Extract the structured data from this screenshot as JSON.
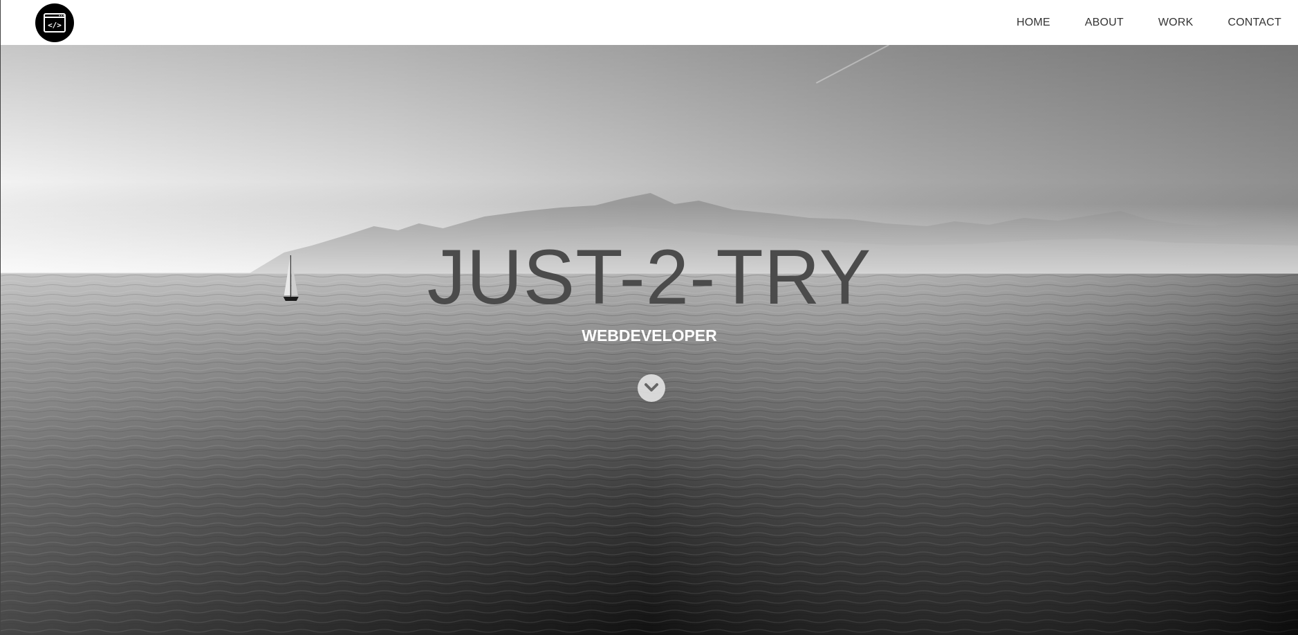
{
  "header": {
    "logo_icon": "code-window-icon",
    "logo_glyph": "</>",
    "nav": [
      {
        "label": "HOME"
      },
      {
        "label": "ABOUT"
      },
      {
        "label": "WORK"
      },
      {
        "label": "CONTACT"
      }
    ]
  },
  "hero": {
    "title": "JUST-2-TRY",
    "subtitle": "WEBDEVELOPER",
    "scroll_icon": "chevron-down-icon",
    "background_image": "sailboat-sea-mountains-grayscale"
  },
  "colors": {
    "header_bg": "#ffffff",
    "nav_text": "#333333",
    "title": "#4b4b4b",
    "subtitle": "#ffffff",
    "logo_bg": "#000000"
  }
}
